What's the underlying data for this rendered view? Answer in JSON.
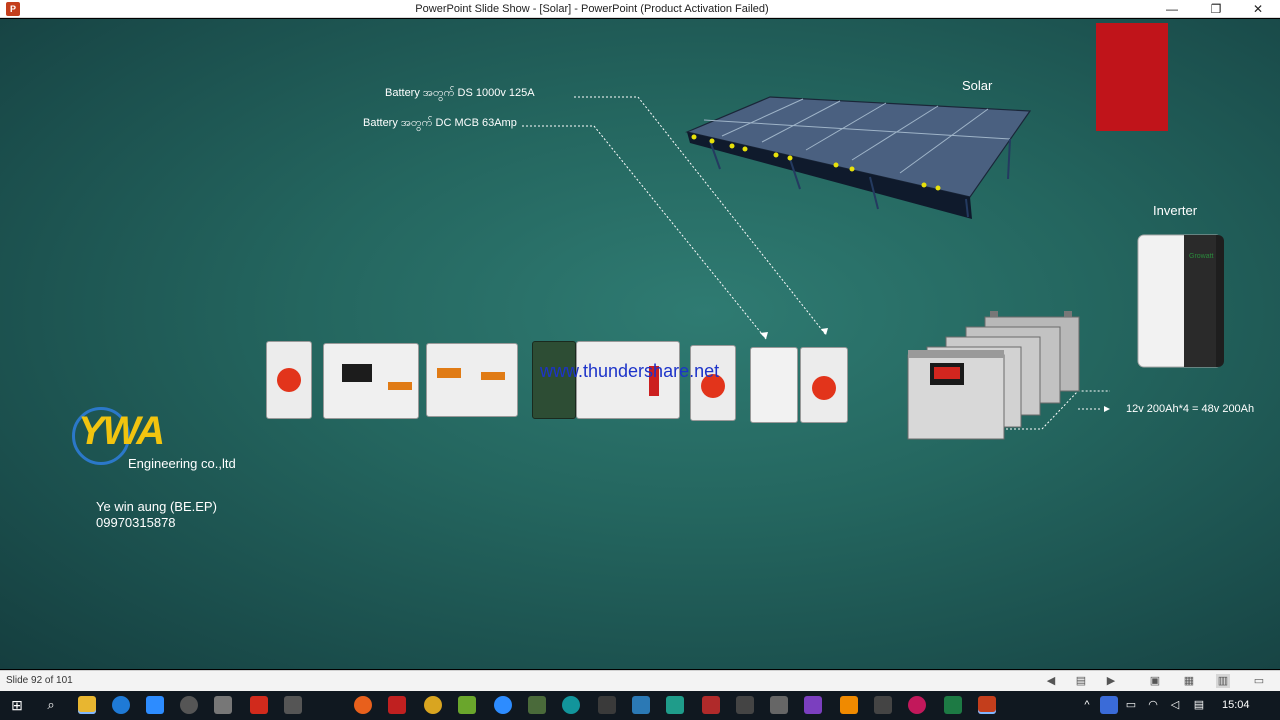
{
  "window": {
    "title": "PowerPoint Slide Show - [Solar] - PowerPoint (Product Activation Failed)",
    "app_icon": "P",
    "minimize_glyph": "—",
    "restore_glyph": "❐",
    "close_glyph": "✕"
  },
  "slide": {
    "label_ds": "Battery အတွက် DS 1000v 125A",
    "label_mcb": "Battery အတွက် DC MCB 63Amp",
    "label_solar": "Solar",
    "label_inverter": "Inverter",
    "battery_spec": "12v 200Ah*4 = 48v 200Ah",
    "watermark": "www.thundershare.net",
    "logo_text": "YWA",
    "company": "Engineering co.,ltd",
    "contact_name": "Ye win aung (BE.EP)",
    "contact_phone": "09970315878",
    "inverter_brand": "Growatt",
    "red_block_color": "#c0141a"
  },
  "statusbar": {
    "slide_indicator": "Slide 92 of 101",
    "buttons": [
      "prev-icon",
      "notes-icon",
      "next-icon",
      "normal-view-icon",
      "slide-sorter-icon",
      "reading-view-icon",
      "slideshow-icon"
    ]
  },
  "taskbar": {
    "clock": "15:04",
    "icons": [
      "windows-start-icon",
      "search-icon",
      "file-explorer-icon",
      "edge-icon",
      "zoom-icon",
      "chrome-icon",
      "settings-icon",
      "acrobat-icon",
      "app-icon",
      "firefox-icon",
      "app-icon",
      "app-icon",
      "app-icon",
      "zoom-icon",
      "app-icon",
      "arduino-icon",
      "app-icon",
      "app-icon",
      "app-icon",
      "app-icon",
      "app-icon",
      "app-icon",
      "app-icon",
      "visual-studio-icon",
      "vlc-icon",
      "app-icon",
      "raspberry-icon",
      "record-icon",
      "excel-icon",
      "powerpoint-icon"
    ]
  }
}
